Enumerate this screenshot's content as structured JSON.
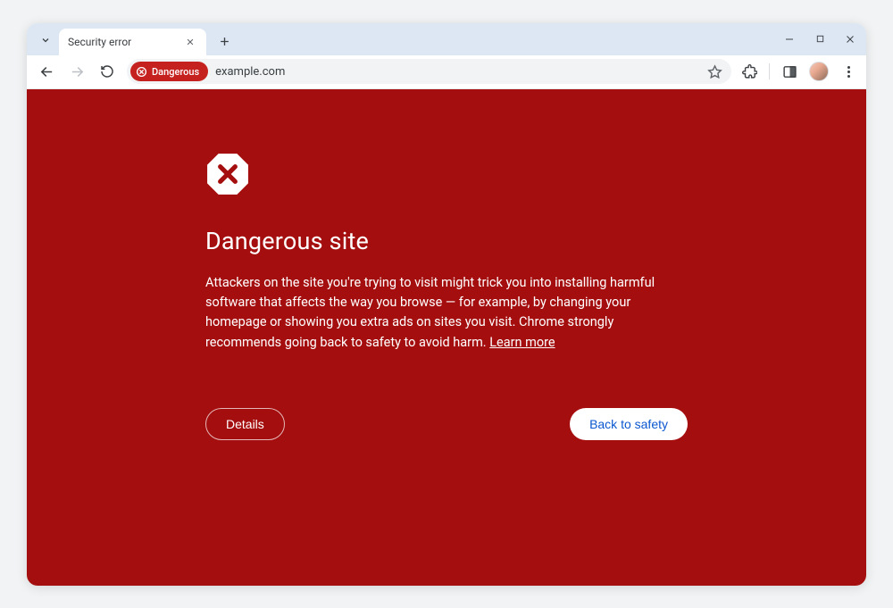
{
  "tab": {
    "title": "Security error"
  },
  "address": {
    "chip_label": "Dangerous",
    "url": "example.com"
  },
  "interstitial": {
    "heading": "Dangerous site",
    "body": "Attackers on the site you're trying to visit might trick you into installing harmful software that affects the way you browse — for example, by changing your homepage or showing you extra ads on sites you visit. Chrome strongly recommends going back to safety to avoid harm. ",
    "learn_more": "Learn more",
    "details_button": "Details",
    "safety_button": "Back to safety"
  },
  "colors": {
    "danger_bg": "#a50e0e",
    "chip_red": "#c5221f",
    "safety_text": "#0b57d0"
  }
}
